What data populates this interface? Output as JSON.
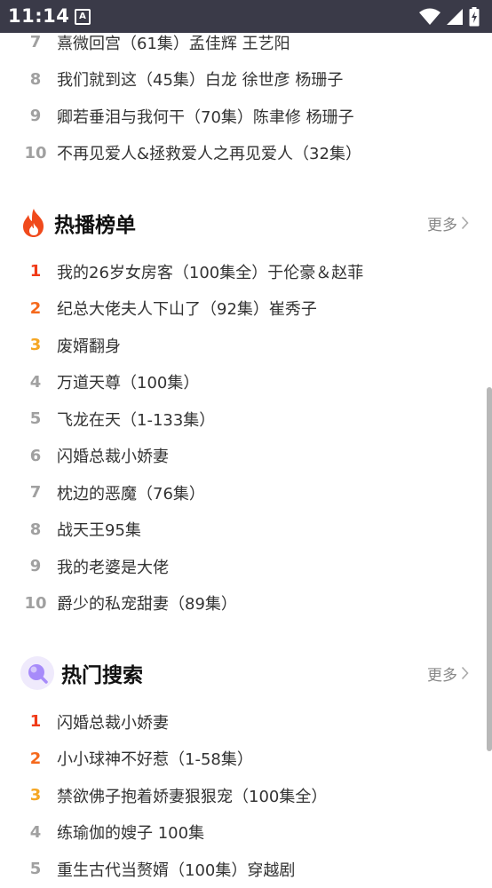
{
  "status_bar": {
    "time": "11:14",
    "notification_letter": "A"
  },
  "top_list": [
    {
      "rank": "7",
      "title": "熹微回宫（61集）孟佳辉 王艺阳"
    },
    {
      "rank": "8",
      "title": "我们就到这（45集）白龙 徐世彦 杨珊子"
    },
    {
      "rank": "9",
      "title": "卿若垂泪与我何干（70集）陈聿修 杨珊子"
    },
    {
      "rank": "10",
      "title": "不再见爱人&拯救爱人之再见爱人（32集）"
    }
  ],
  "hot_play": {
    "title": "热播榜单",
    "more": "更多",
    "items": [
      {
        "rank": "1",
        "title": "我的26岁女房客（100集全）于伦豪＆赵菲"
      },
      {
        "rank": "2",
        "title": "纪总大佬夫人下山了（92集）崔秀子"
      },
      {
        "rank": "3",
        "title": "废婿翻身"
      },
      {
        "rank": "4",
        "title": "万道天尊（100集）"
      },
      {
        "rank": "5",
        "title": "飞龙在天（1-133集）"
      },
      {
        "rank": "6",
        "title": "闪婚总裁小娇妻"
      },
      {
        "rank": "7",
        "title": "枕边的恶魔（76集）"
      },
      {
        "rank": "8",
        "title": "战天王95集"
      },
      {
        "rank": "9",
        "title": "我的老婆是大佬"
      },
      {
        "rank": "10",
        "title": "爵少的私宠甜妻（89集）"
      }
    ]
  },
  "hot_search": {
    "title": "热门搜索",
    "more": "更多",
    "items": [
      {
        "rank": "1",
        "title": "闪婚总裁小娇妻"
      },
      {
        "rank": "2",
        "title": "小小球神不好惹（1-58集）"
      },
      {
        "rank": "3",
        "title": "禁欲佛子抱着娇妻狠狠宠（100集全）"
      },
      {
        "rank": "4",
        "title": "练瑜伽的嫂子 100集"
      },
      {
        "rank": "5",
        "title": "重生古代当赘婿（100集）穿越剧"
      }
    ]
  },
  "colors": {
    "rank_1": "#f03a17",
    "rank_2": "#f5691c",
    "rank_3": "#f5a623",
    "rank_other": "#a0a0a0",
    "status_bar_bg": "#3a3a48",
    "fire_icon": "#f04a1c",
    "search_icon": "#a78bfa"
  }
}
